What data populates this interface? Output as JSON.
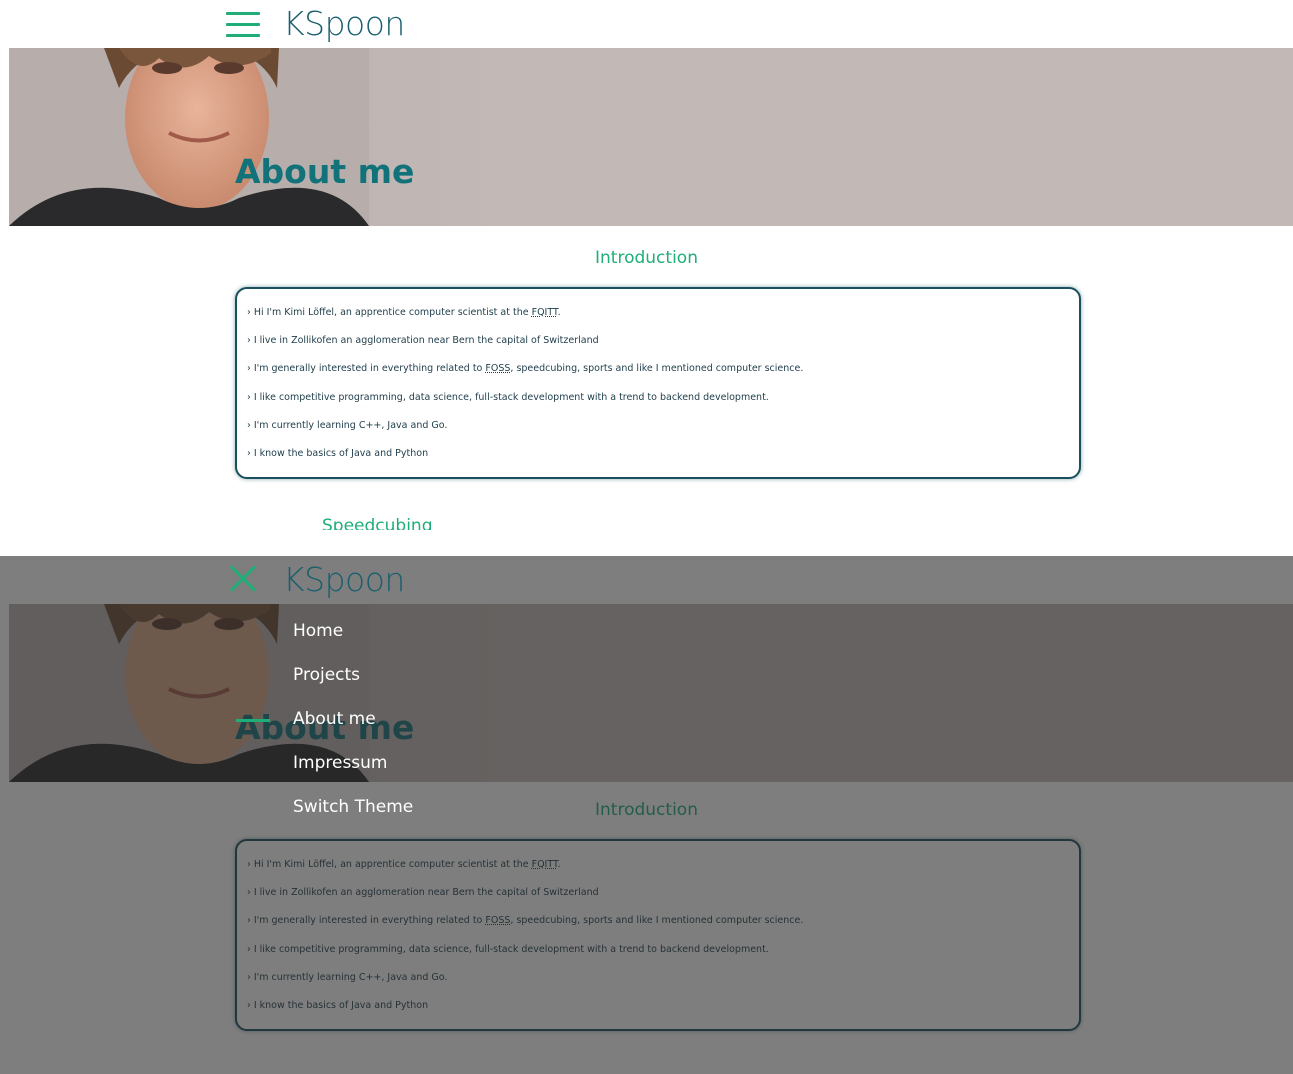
{
  "header": {
    "brand": "KSpoon"
  },
  "hero": {
    "title": "About me"
  },
  "intro": {
    "title": "Introduction",
    "lines": [
      {
        "pre": "› Hi I'm Kimi Löffel, an apprentice computer scientist at the ",
        "abbr": "FQITT",
        "post": "."
      },
      {
        "pre": "› I live in Zollikofen an agglomeration near Bern the capital of Switzerland",
        "abbr": "",
        "post": ""
      },
      {
        "pre": "› I'm generally interested in everything related to ",
        "abbr": "FOSS",
        "post": ", speedcubing, sports and like I mentioned computer science."
      },
      {
        "pre": "› I like competitive programming, data science, full-stack development with a trend to backend development.",
        "abbr": "",
        "post": ""
      },
      {
        "pre": "› I'm currently learning C++, Java and Go.",
        "abbr": "",
        "post": ""
      },
      {
        "pre": "› I know the basics of Java and Python",
        "abbr": "",
        "post": ""
      }
    ]
  },
  "next_section": {
    "title": "Speedcubing"
  },
  "menu": {
    "items": [
      {
        "label": "Home",
        "active": false
      },
      {
        "label": "Projects",
        "active": false
      },
      {
        "label": "About me",
        "active": true
      },
      {
        "label": "Impressum",
        "active": false
      },
      {
        "label": "Switch Theme",
        "active": false
      }
    ]
  },
  "colors": {
    "accent": "#1fae78",
    "title": "#12727a",
    "border": "#1a4f5e"
  }
}
